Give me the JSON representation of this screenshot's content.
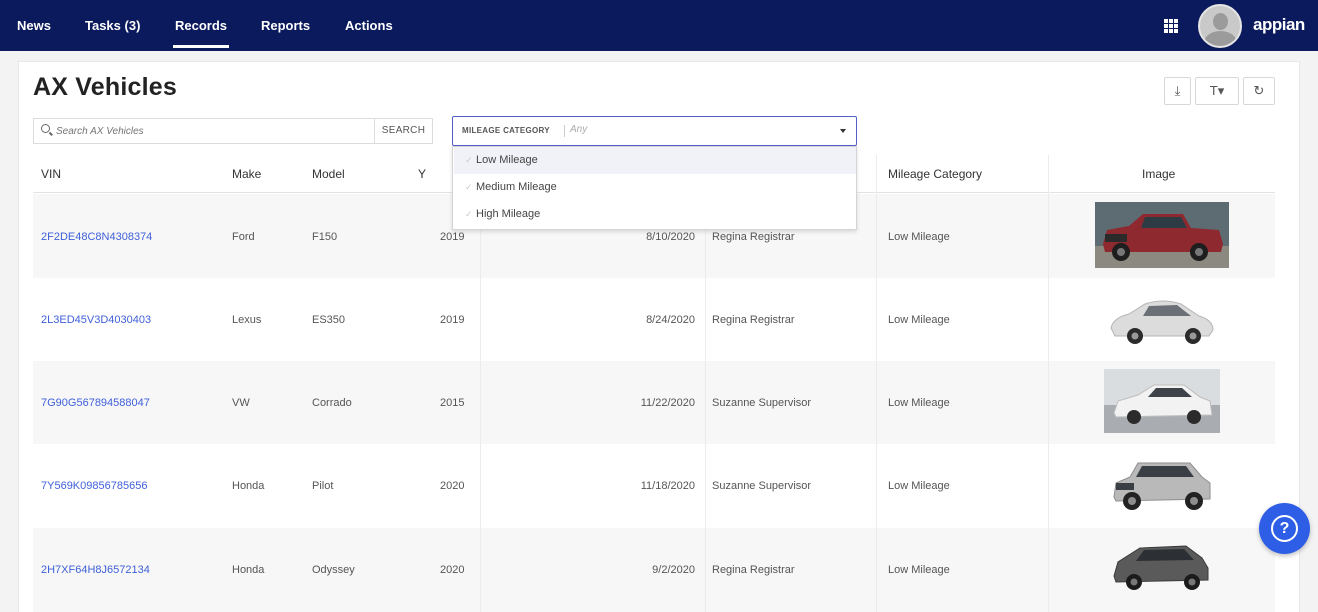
{
  "nav": {
    "tabs": [
      {
        "label": "News"
      },
      {
        "label": "Tasks (3)"
      },
      {
        "label": "Records"
      },
      {
        "label": "Reports"
      },
      {
        "label": "Actions"
      }
    ],
    "active_tab": "Records",
    "brand": "appian",
    "color": "#0b1a5c"
  },
  "page": {
    "title": "AX Vehicles",
    "tools": {
      "export": "⤓",
      "filter": "T▾",
      "refresh": "↻"
    }
  },
  "search": {
    "placeholder": "Search AX Vehicles",
    "button_label": "SEARCH"
  },
  "filter": {
    "label": "MILEAGE CATEGORY",
    "value": "Any",
    "options": [
      "Low Mileage",
      "Medium Mileage",
      "High Mileage"
    ]
  },
  "table": {
    "columns": [
      "VIN",
      "Make",
      "Model",
      "Y",
      "",
      "",
      "Mileage Category",
      "Image"
    ],
    "rows": [
      {
        "vin": "2F2DE48C8N4308374",
        "make": "Ford",
        "model": "F150",
        "year": "2019",
        "date": "8/10/2020",
        "user": "Regina Registrar",
        "mileage": "Low Mileage",
        "image_color": "#8e2a2f"
      },
      {
        "vin": "2L3ED45V3D4030403",
        "make": "Lexus",
        "model": "ES350",
        "year": "2019",
        "date": "8/24/2020",
        "user": "Regina Registrar",
        "mileage": "Low Mileage",
        "image_color": "#d9d9d9"
      },
      {
        "vin": "7G90G567894588047",
        "make": "VW",
        "model": "Corrado",
        "year": "2015",
        "date": "11/22/2020",
        "user": "Suzanne Supervisor",
        "mileage": "Low Mileage",
        "image_color": "#e9e9ea"
      },
      {
        "vin": "7Y569K09856785656",
        "make": "Honda",
        "model": "Pilot",
        "year": "2020",
        "date": "11/18/2020",
        "user": "Suzanne Supervisor",
        "mileage": "Low Mileage",
        "image_color": "#b9b9b9"
      },
      {
        "vin": "2H7XF64H8J6572134",
        "make": "Honda",
        "model": "Odyssey",
        "year": "2020",
        "date": "9/2/2020",
        "user": "Regina Registrar",
        "mileage": "Low Mileage",
        "image_color": "#5a5a5a"
      }
    ]
  },
  "help": {
    "glyph": "?"
  }
}
